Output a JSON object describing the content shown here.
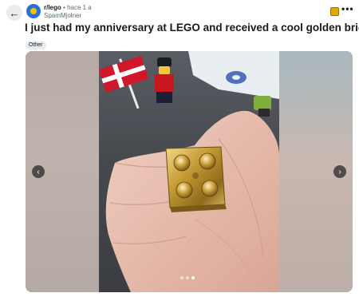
{
  "header": {
    "back_icon": "arrow-left-icon",
    "subreddit": "r/lego",
    "separator": "•",
    "age": "hace 1 a",
    "author": "SpamMjolner",
    "more_label": "•••"
  },
  "post": {
    "title": "I just had my anniversary at LEGO and received a cool golden brick",
    "flair": "Other"
  },
  "gallery": {
    "prev_label": "‹",
    "next_label": "›",
    "slide_count": 3,
    "current_slide": 3
  },
  "colors": {
    "gallery_background": "#a8a4a2",
    "flair_background": "#e5ebee",
    "brick": "#c9a23a"
  }
}
